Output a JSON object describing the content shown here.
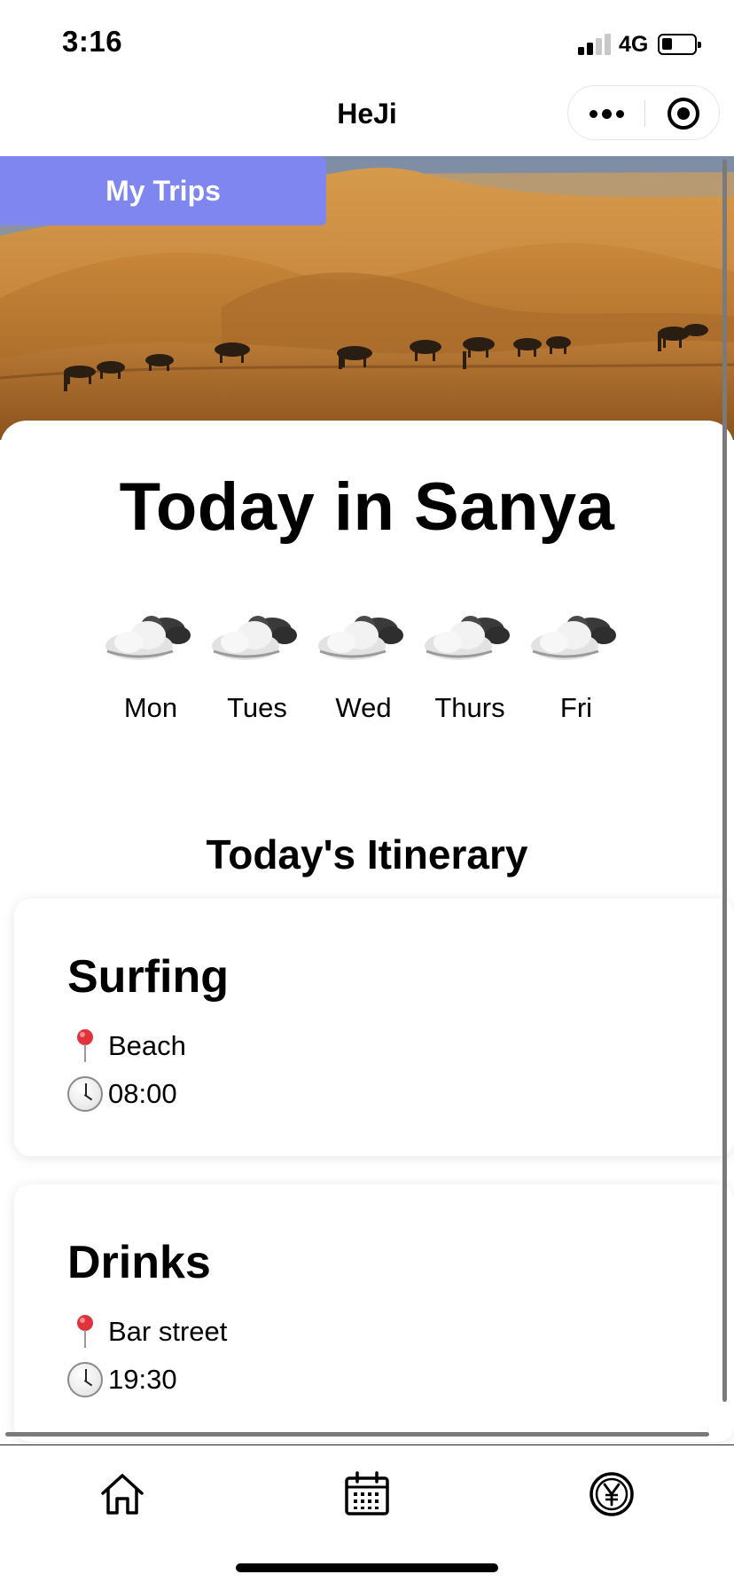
{
  "status_bar": {
    "time": "3:16",
    "network": "4G",
    "icons": [
      "signal-icon",
      "battery-icon"
    ]
  },
  "nav": {
    "title": "HeJi",
    "more_icon": "more-icon",
    "close_icon": "close-target-icon"
  },
  "hero": {
    "button_label": "My Trips",
    "image": "desert-camel-caravan"
  },
  "main": {
    "city_title": "Today in Sanya",
    "forecast": [
      {
        "day": "Mon",
        "icon": "partly-cloudy-icon"
      },
      {
        "day": "Tues",
        "icon": "partly-cloudy-icon"
      },
      {
        "day": "Wed",
        "icon": "partly-cloudy-icon"
      },
      {
        "day": "Thurs",
        "icon": "partly-cloudy-icon"
      },
      {
        "day": "Fri",
        "icon": "partly-cloudy-icon"
      }
    ],
    "itinerary_title": "Today's Itinerary",
    "itinerary": [
      {
        "name": "Surfing",
        "location": "Beach",
        "time": "08:00"
      },
      {
        "name": "Drinks",
        "location": "Bar street",
        "time": "19:30"
      }
    ]
  },
  "tab_bar": {
    "items": [
      {
        "icon": "home-icon"
      },
      {
        "icon": "calendar-icon"
      },
      {
        "icon": "yen-coin-icon"
      }
    ]
  },
  "colors": {
    "accent": "#7f86f0",
    "sand": "#c98a3e",
    "sky": "#8b9ab0"
  }
}
